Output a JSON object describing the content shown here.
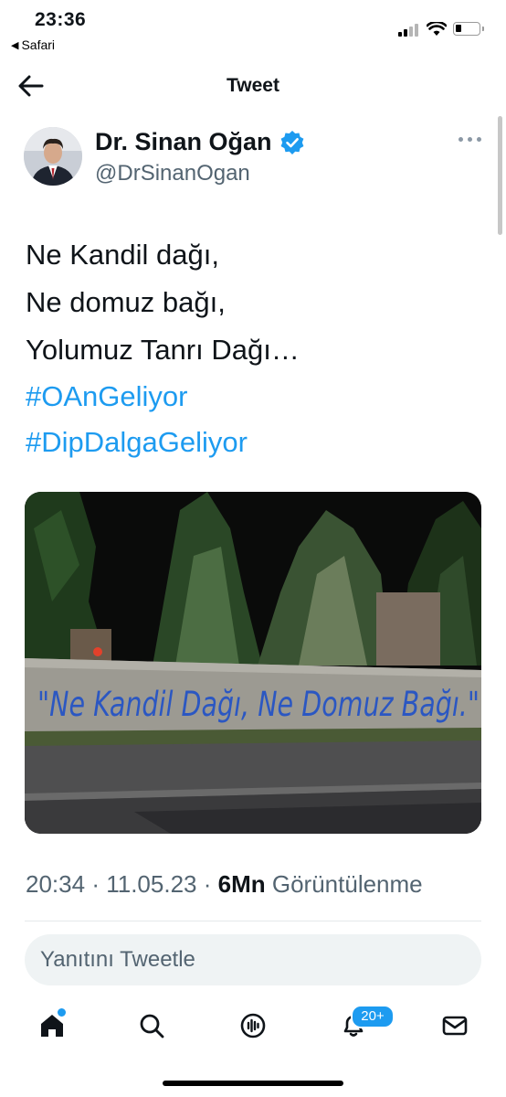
{
  "status_bar": {
    "time": "23:36",
    "back_app": "Safari"
  },
  "header": {
    "title": "Tweet",
    "back_icon": "arrow-left-icon"
  },
  "author": {
    "display_name": "Dr. Sinan Oğan",
    "handle": "@DrSinanOgan",
    "verified": true
  },
  "tweet": {
    "lines": [
      "Ne Kandil dağı,",
      "Ne domuz bağı,",
      "Yolumuz Tanrı Dağı…"
    ],
    "hashtags": [
      "#OAnGeliyor",
      "#DipDalgaGeliyor"
    ],
    "photo_text": "\"Ne Kandil Dağı, Ne Domuz Bağı.\""
  },
  "meta": {
    "time": "20:34",
    "separator": "·",
    "date": "11.05.23",
    "views_count": "6Mn",
    "views_label": "Görüntülenme"
  },
  "reply": {
    "placeholder": "Yanıtını Tweetle"
  },
  "tabbar": {
    "notifications_badge": "20+"
  },
  "colors": {
    "accent": "#1d9bf0",
    "text": "#0f1419",
    "secondary": "#536471"
  }
}
